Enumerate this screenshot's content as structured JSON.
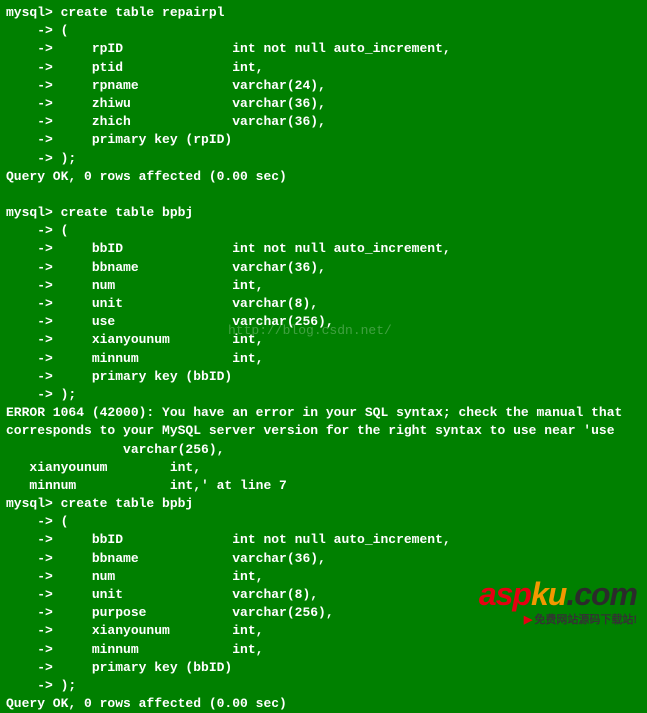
{
  "lines": [
    "mysql> create table repairpl",
    "    -> (",
    "    ->     rpID              int not null auto_increment,",
    "    ->     ptid              int,",
    "    ->     rpname            varchar(24),",
    "    ->     zhiwu             varchar(36),",
    "    ->     zhich             varchar(36),",
    "    ->     primary key (rpID)",
    "    -> );",
    "Query OK, 0 rows affected (0.00 sec)",
    "",
    "mysql> create table bpbj",
    "    -> (",
    "    ->     bbID              int not null auto_increment,",
    "    ->     bbname            varchar(36),",
    "    ->     num               int,",
    "    ->     unit              varchar(8),",
    "    ->     use               varchar(256),",
    "    ->     xianyounum        int,",
    "    ->     minnum            int,",
    "    ->     primary key (bbID)",
    "    -> );",
    "ERROR 1064 (42000): You have an error in your SQL syntax; check the manual that",
    "corresponds to your MySQL server version for the right syntax to use near 'use",
    "               varchar(256),",
    "   xianyounum        int,",
    "   minnum            int,' at line 7",
    "mysql> create table bpbj",
    "    -> (",
    "    ->     bbID              int not null auto_increment,",
    "    ->     bbname            varchar(36),",
    "    ->     num               int,",
    "    ->     unit              varchar(8),",
    "    ->     purpose           varchar(256),",
    "    ->     xianyounum        int,",
    "    ->     minnum            int,",
    "    ->     primary key (bbID)",
    "    -> );",
    "Query OK, 0 rows affected (0.00 sec)"
  ],
  "watermark": "http://blog.csdn.net/",
  "logo": {
    "text_asp": "asp",
    "text_ku": "ku",
    "text_dotcom": ".com",
    "subtitle": "免费网站源码下载站!",
    "arrow": "▶"
  }
}
